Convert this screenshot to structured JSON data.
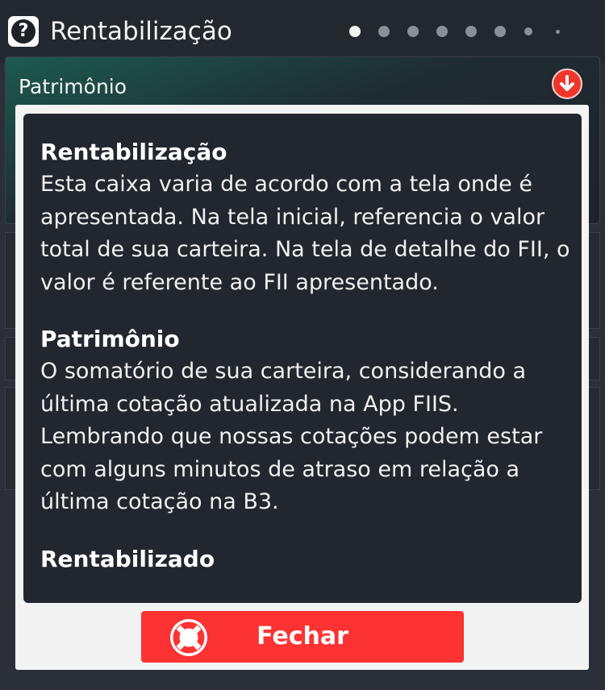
{
  "header": {
    "title": "Rentabilização",
    "help_icon": "question-mark-icon",
    "page_count": 8,
    "active_page": 1
  },
  "background": {
    "card_label": "Patrimônio",
    "card_icon": "arrow-down-circle-icon"
  },
  "modal": {
    "sections": [
      {
        "title": "Rentabilização",
        "body": "Esta caixa varia de acordo com a tela onde é apresentada. Na tela inicial, referencia o valor total de sua carteira. Na tela de detalhe do FII, o valor é referente ao FII apresentado."
      },
      {
        "title": "Patrimônio",
        "body": "O somatório de sua carteira, considerando a última cotação atualizada na App FIIS. Lembrando que nossas cotações podem estar com alguns minutos de atraso em relação a última cotação na B3."
      },
      {
        "title": "Rentabilizado",
        "body": ""
      }
    ],
    "close_label": "Fechar",
    "close_icon": "lifebuoy-icon"
  },
  "colors": {
    "accent_red": "#fd3232",
    "modal_bg": "#22272f",
    "frame_bg": "#f3f3f3"
  }
}
